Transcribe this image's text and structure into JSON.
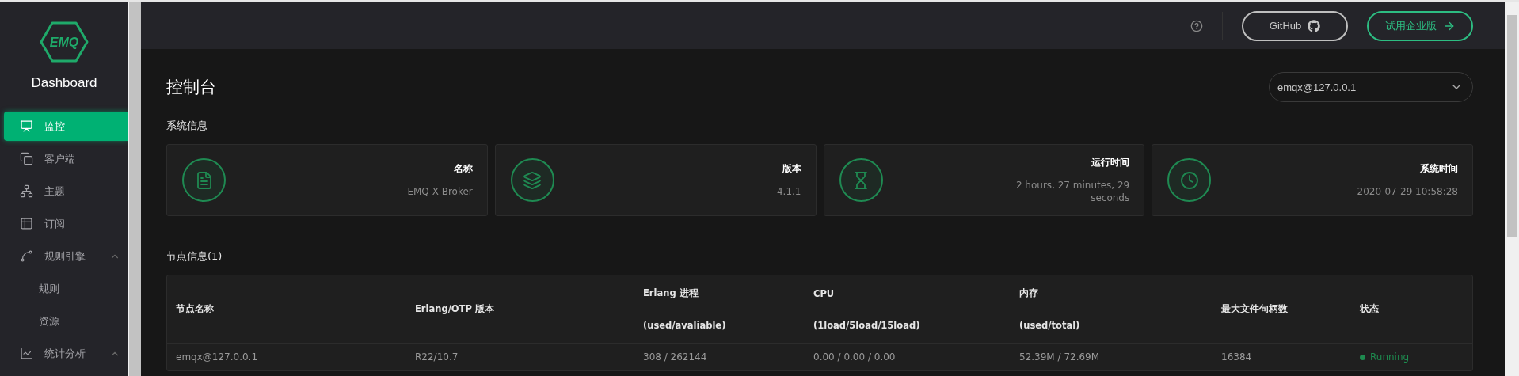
{
  "sidebar": {
    "logo": "EMQ",
    "title": "Dashboard",
    "items": [
      {
        "label": "监控",
        "kind": "monitor",
        "selected": true
      },
      {
        "label": "客户端",
        "kind": "clients",
        "selected": false
      },
      {
        "label": "主题",
        "kind": "topics",
        "selected": false
      },
      {
        "label": "订阅",
        "kind": "subscriptions",
        "selected": false
      },
      {
        "label": "规则引擎",
        "kind": "rules",
        "selected": false,
        "expanded": true,
        "children": [
          {
            "label": "规则",
            "selected": false
          },
          {
            "label": "资源",
            "selected": false
          }
        ]
      },
      {
        "label": "统计分析",
        "kind": "analytics",
        "selected": false,
        "expanded": true
      }
    ]
  },
  "header": {
    "github": "GitHub",
    "enterprise": "试用企业版"
  },
  "page": {
    "title": "控制台",
    "node_select": "emqx@127.0.0.1"
  },
  "system_info": {
    "title": "系统信息",
    "cards": [
      {
        "kind": "file",
        "label": "名称",
        "value": "EMQ X Broker"
      },
      {
        "kind": "layers",
        "label": "版本",
        "value": "4.1.1"
      },
      {
        "kind": "hourglass",
        "label": "运行时间",
        "value": "2 hours, 27 minutes, 29 seconds"
      },
      {
        "kind": "clock",
        "label": "系统时间",
        "value": "2020-07-29 10:58:28"
      }
    ]
  },
  "nodes": {
    "title": "节点信息(1)",
    "columns": [
      {
        "title": "节点名称"
      },
      {
        "title": "Erlang/OTP 版本"
      },
      {
        "title": "Erlang 进程",
        "subtitle": "(used/avaliable)"
      },
      {
        "title": "CPU",
        "subtitle": "(1load/5load/15load)"
      },
      {
        "title": "内存",
        "subtitle": "(used/total)"
      },
      {
        "title": "最大文件句柄数"
      },
      {
        "title": "状态"
      }
    ],
    "rows": [
      {
        "cells": [
          "emqx@127.0.0.1",
          "R22/10.7",
          "308 / 262144",
          "0.00 / 0.00 / 0.00",
          "52.39M / 72.69M",
          "16384"
        ],
        "status": {
          "kind": "running",
          "text": "Running"
        }
      }
    ]
  }
}
